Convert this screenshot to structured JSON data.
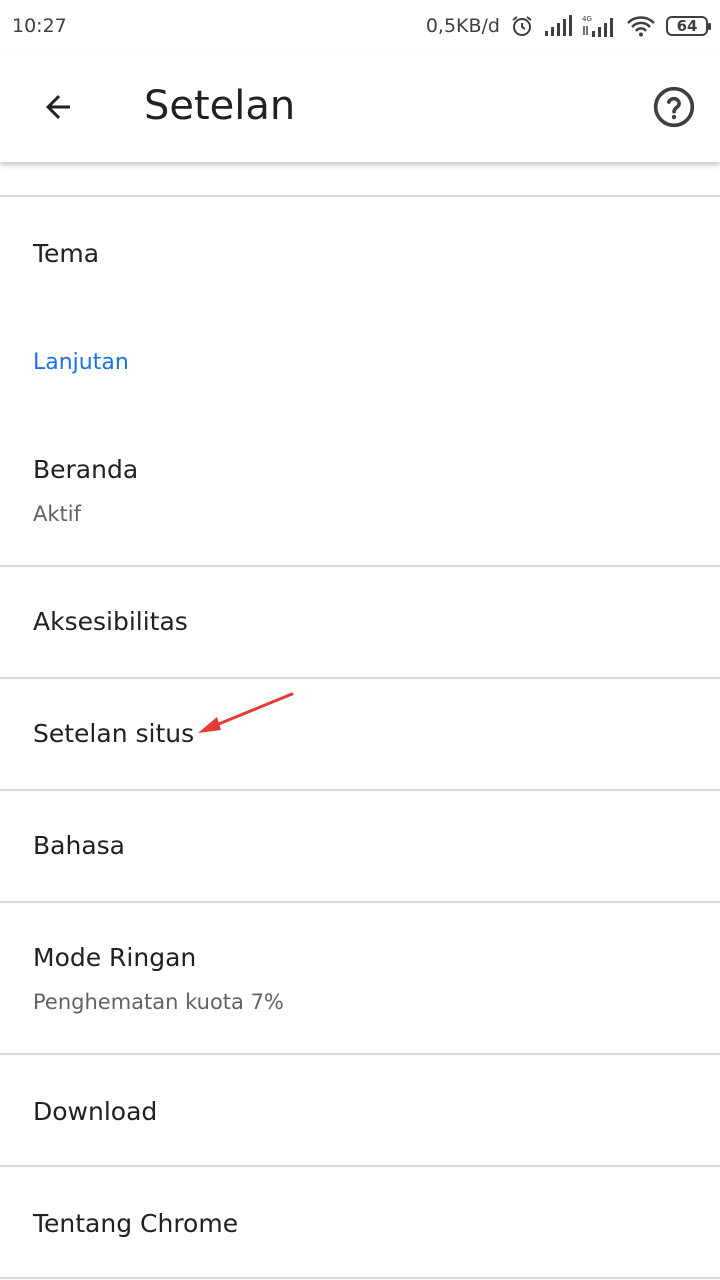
{
  "status_bar": {
    "time": "10:27",
    "network_speed": "0,5KB/d",
    "battery": "64",
    "icons": [
      "alarm-icon",
      "signal-icon",
      "signal-4g-icon",
      "wifi-icon",
      "battery-icon"
    ]
  },
  "app_bar": {
    "title": "Setelan",
    "back_icon": "arrow-back-icon",
    "help_icon": "help-circle-icon"
  },
  "items": {
    "tema": {
      "label": "Tema"
    },
    "section_advanced": {
      "label": "Lanjutan"
    },
    "beranda": {
      "label": "Beranda",
      "summary": "Aktif"
    },
    "aksesibilitas": {
      "label": "Aksesibilitas"
    },
    "setelan_situs": {
      "label": "Setelan situs"
    },
    "bahasa": {
      "label": "Bahasa"
    },
    "mode_ringan": {
      "label": "Mode Ringan",
      "summary": "Penghematan kuota 7%"
    },
    "download": {
      "label": "Download"
    },
    "tentang_chrome": {
      "label": "Tentang Chrome"
    }
  },
  "colors": {
    "accent": "#1a73e8",
    "annotation_arrow": "#e53935",
    "divider": "#dadce0"
  }
}
